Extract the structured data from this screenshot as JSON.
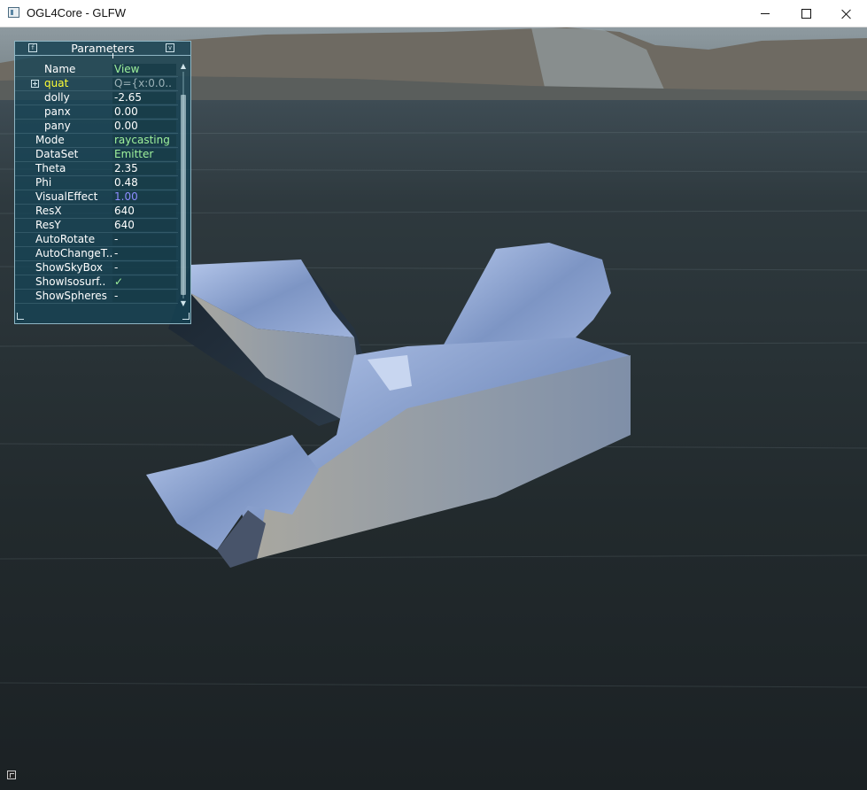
{
  "window": {
    "title": "OGL4Core - GLFW"
  },
  "panel": {
    "title": "Parameters",
    "help_glyph": "f",
    "iconify_glyph": "v",
    "scroll_up": "▲",
    "scroll_down": "▼",
    "rows": [
      {
        "label": "Name",
        "value": "View"
      },
      {
        "label": "quat",
        "value": "Q={x:0.0.."
      },
      {
        "label": "dolly",
        "value": "-2.65"
      },
      {
        "label": "panx",
        "value": "0.00"
      },
      {
        "label": "pany",
        "value": "0.00"
      },
      {
        "label": "Mode",
        "value": "raycasting"
      },
      {
        "label": "DataSet",
        "value": "Emitter"
      },
      {
        "label": "Theta",
        "value": "2.35"
      },
      {
        "label": "Phi",
        "value": "0.48"
      },
      {
        "label": "VisualEffect",
        "value": "1.00"
      },
      {
        "label": "ResX",
        "value": "640"
      },
      {
        "label": "ResY",
        "value": "640"
      },
      {
        "label": "AutoRotate",
        "value": "-"
      },
      {
        "label": "AutoChangeT..",
        "value": "-"
      },
      {
        "label": "ShowSkyBox",
        "value": "-"
      },
      {
        "label": "ShowIsosurf..",
        "value": "✓"
      },
      {
        "label": "ShowSpheres",
        "value": "-"
      }
    ]
  },
  "colors": {
    "panel_bg": "#164456",
    "value_green": "#9ff29c",
    "label_yellow": "#ffff35",
    "value_blue": "#8c8cff",
    "water": "#1e2628",
    "object_metal": "#8fa7d6"
  },
  "icons": {
    "app": "window-app-icon",
    "minimize": "minimize-icon",
    "maximize": "maximize-icon",
    "close": "close-icon",
    "corner": "resize-corner-icon"
  }
}
